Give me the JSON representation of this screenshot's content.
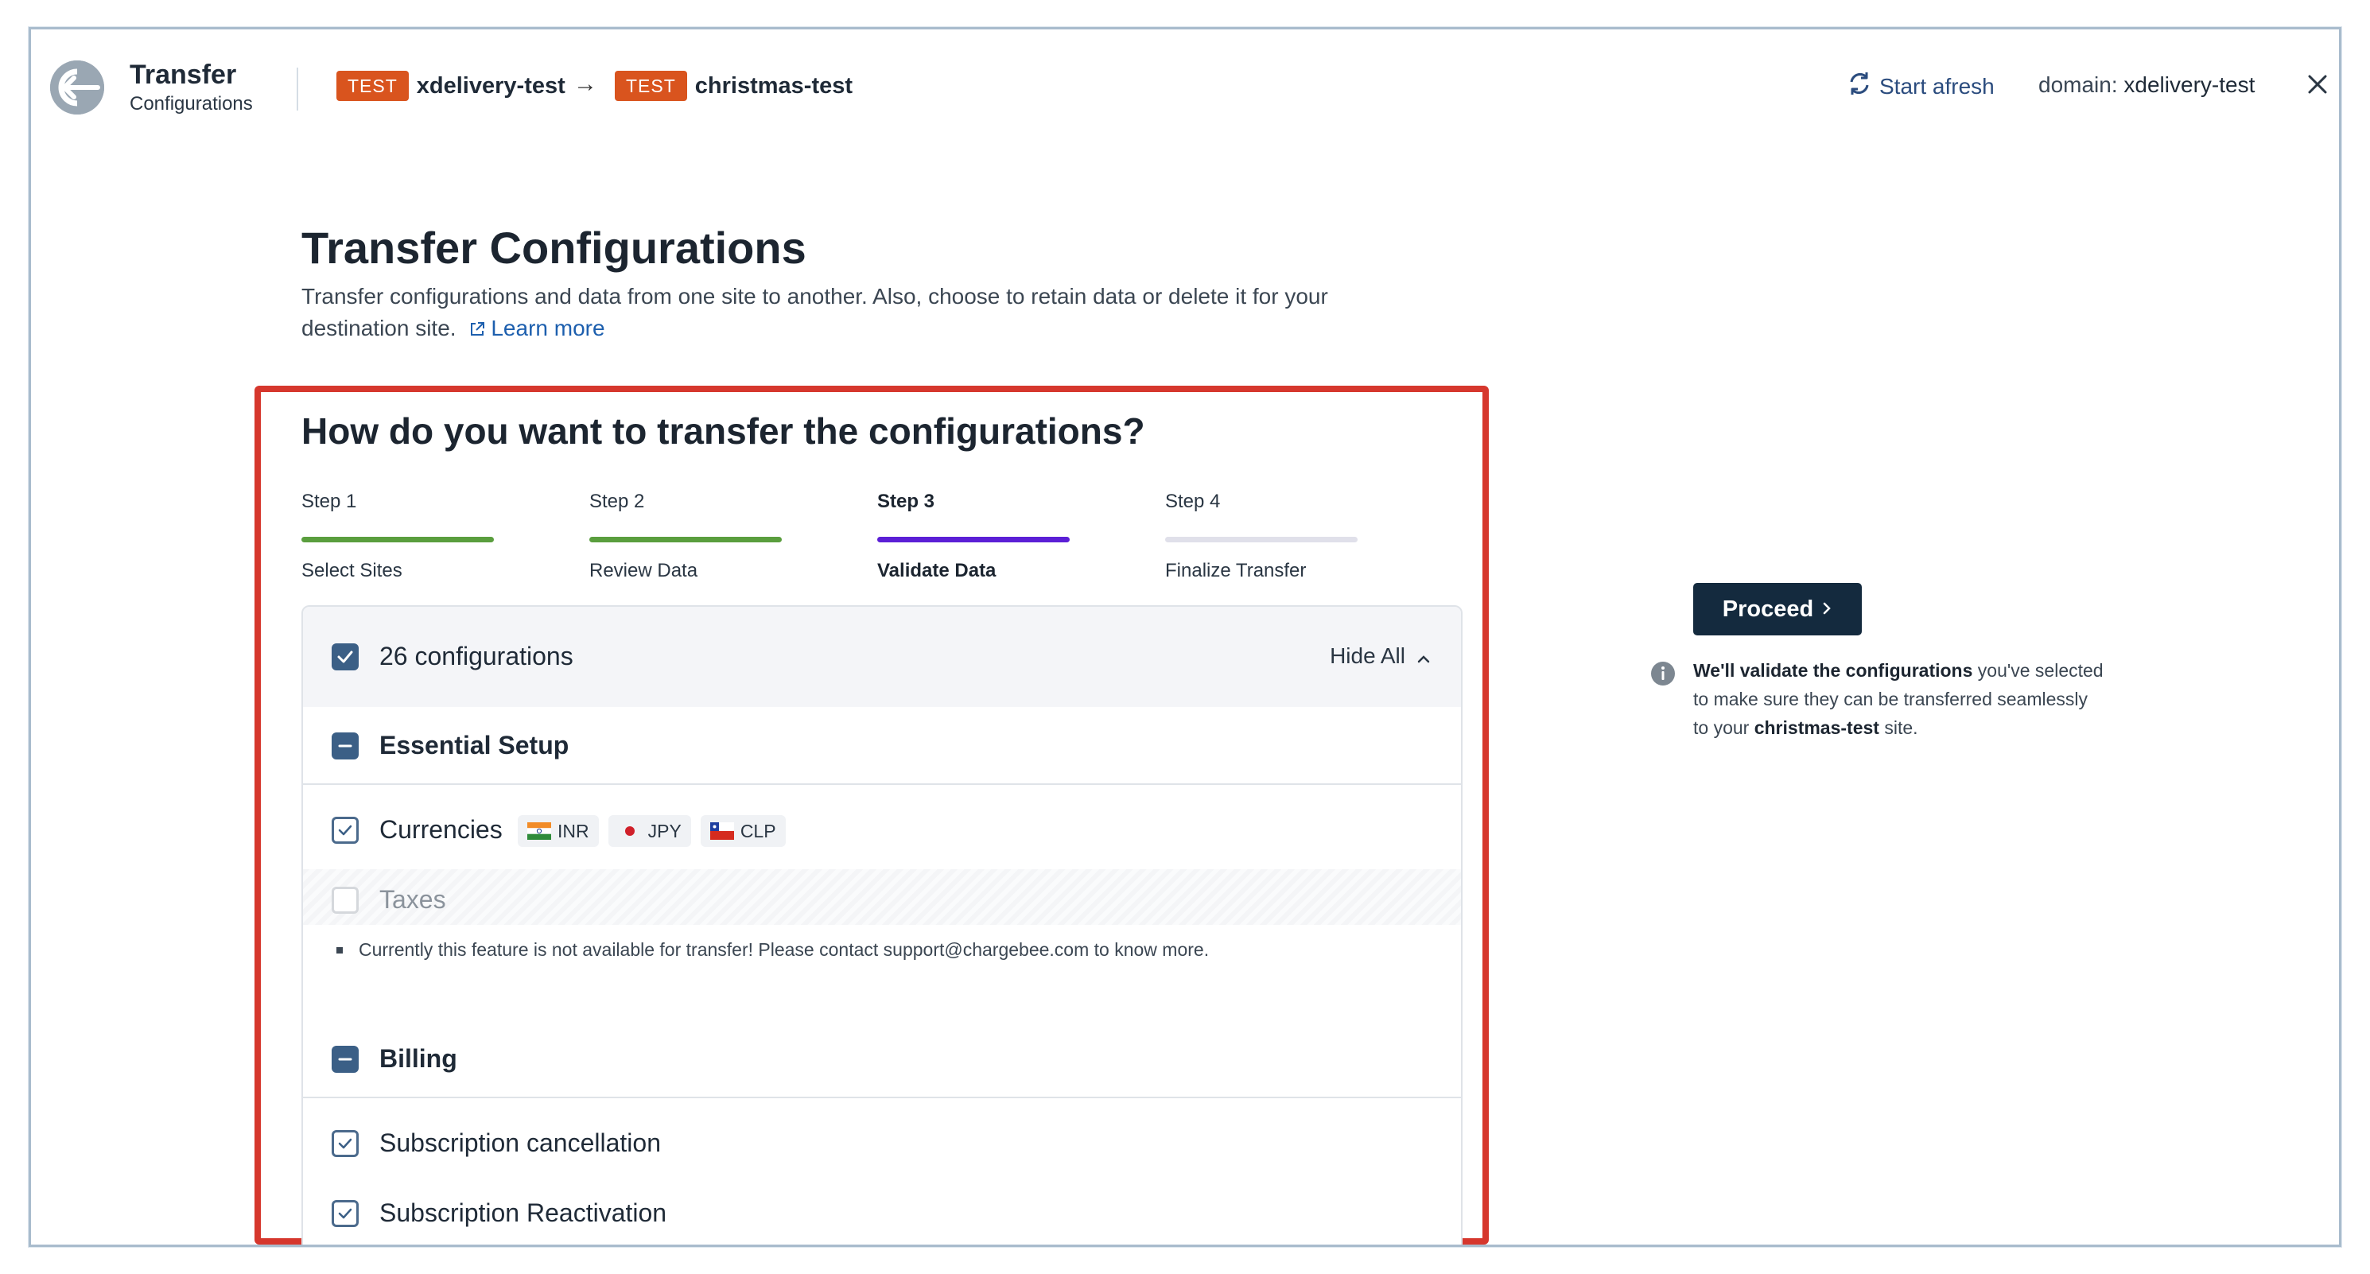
{
  "header": {
    "app_title": "Transfer",
    "app_subtitle": "Configurations",
    "source": {
      "badge": "TEST",
      "name": "xdelivery-test"
    },
    "destination": {
      "badge": "TEST",
      "name": "christmas-test"
    },
    "arrow": "→",
    "start_afresh": "Start afresh",
    "domain_label": "domain:",
    "domain_value": "xdelivery-test"
  },
  "intro": {
    "title": "Transfer Configurations",
    "description": "Transfer configurations and data from one site to another. Also, choose to retain data or delete it for your destination site.",
    "learn_more": "Learn more"
  },
  "wizard": {
    "question": "How do you want to transfer the configurations?",
    "steps": [
      {
        "label": "Step 1",
        "name": "Select Sites",
        "status": "complete",
        "color": "#5a9e3e"
      },
      {
        "label": "Step 2",
        "name": "Review Data",
        "status": "complete",
        "color": "#5a9e3e"
      },
      {
        "label": "Step 3",
        "name": "Validate Data",
        "status": "active",
        "color": "#5b1fd6"
      },
      {
        "label": "Step 4",
        "name": "Finalize Transfer",
        "status": "pending",
        "color": "#e0e0ea"
      }
    ]
  },
  "config_panel": {
    "header_label": "26 configurations",
    "hide_all": "Hide All",
    "sections": [
      {
        "title": "Essential Setup",
        "items": [
          {
            "label": "Currencies",
            "checked": true,
            "currencies": [
              "INR",
              "JPY",
              "CLP"
            ]
          },
          {
            "label": "Taxes",
            "checked": false,
            "disabled": true,
            "note": "Currently this feature is not available for transfer! Please contact support@chargebee.com to know more."
          }
        ]
      },
      {
        "title": "Billing",
        "items": [
          {
            "label": "Subscription cancellation",
            "checked": true
          },
          {
            "label": "Subscription Reactivation",
            "checked": true
          }
        ]
      }
    ]
  },
  "sidebar": {
    "proceed": "Proceed",
    "info_bold_1": "We'll validate the configurations",
    "info_text_1": " you've selected to make sure they can be transferred seamlessly to your ",
    "info_bold_2": "christmas-test",
    "info_text_2": " site."
  },
  "colors": {
    "accent": "#d9541e",
    "highlight_border": "#d6372d",
    "primary_button": "#142a3e",
    "link": "#1d5fae"
  }
}
